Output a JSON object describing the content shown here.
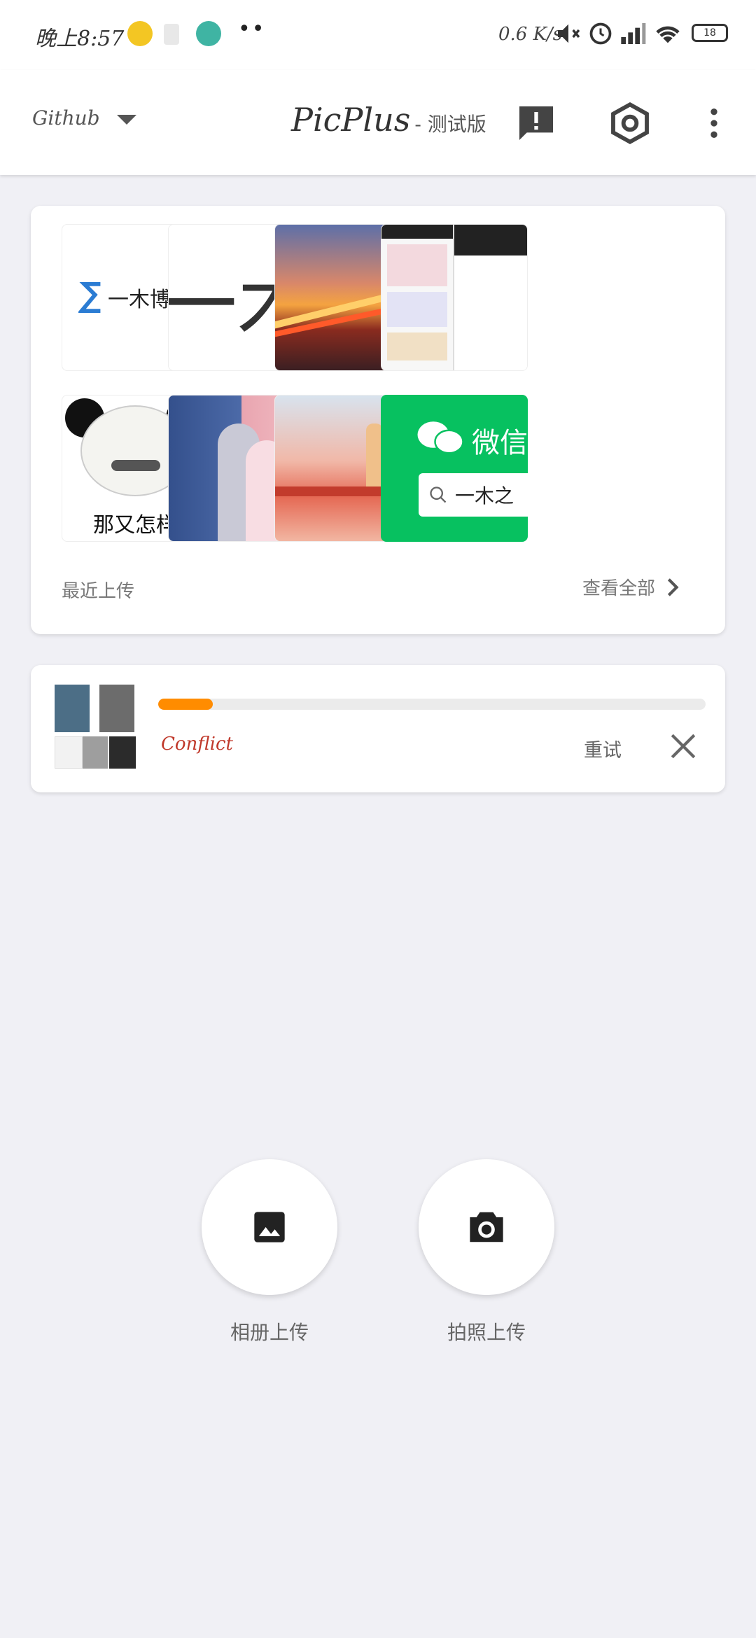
{
  "status_bar": {
    "time": "晚上8:57",
    "net_speed": "0.6 K/s",
    "battery": "18",
    "icons": [
      "music-app-icon",
      "photo-icon",
      "browser-icon",
      "more-dots-icon",
      "mute-icon",
      "alarm-icon",
      "signal-icon",
      "wifi-icon",
      "battery-icon"
    ]
  },
  "app_bar": {
    "source_label": "Github",
    "title": "PicPlus",
    "subtitle": "- 测试版",
    "icons": [
      "feedback-icon",
      "settings-icon",
      "more-vert-icon"
    ]
  },
  "recent": {
    "section_label": "最近上传",
    "view_all_label": "查看全部",
    "images": [
      {
        "name": "blog-logo",
        "text": "一木博客"
      },
      {
        "name": "big-text-image",
        "text": "一木"
      },
      {
        "name": "sunset-road-image",
        "text": ""
      },
      {
        "name": "app-screenshot-image",
        "text": ""
      },
      {
        "name": "panda-meme-image",
        "text": "那又怎样"
      },
      {
        "name": "couple-illustration-image",
        "text": ""
      },
      {
        "name": "bridge-illustration-image",
        "text": ""
      },
      {
        "name": "wechat-search-image",
        "text": "微信",
        "search_text": "一木之"
      }
    ]
  },
  "upload_task": {
    "progress": 0.1,
    "status": "Conflict",
    "retry_label": "重试"
  },
  "actions": {
    "album_label": "相册上传",
    "camera_label": "拍照上传"
  },
  "colors": {
    "accent": "#ff8c00",
    "error": "#c0392b",
    "background": "#f0f0f5"
  }
}
